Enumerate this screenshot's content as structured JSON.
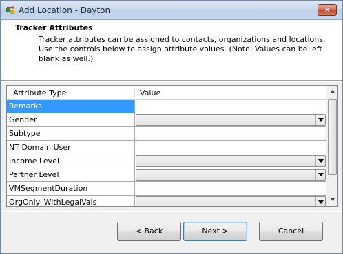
{
  "window": {
    "title": "Add Location - Dayton"
  },
  "header": {
    "title": "Tracker Attributes",
    "description": "Tracker attributes can be assigned to contacts, organizations and locations.  Use the controls below to assign attribute values.  (Note: Values can be left blank as well.)"
  },
  "grid": {
    "columns": [
      "Attribute Type",
      "Value"
    ],
    "rows": [
      {
        "label": "Remarks",
        "value": ""
      },
      {
        "label": "Gender",
        "value": ""
      },
      {
        "label": "Subtype",
        "value": ""
      },
      {
        "label": "NT Domain User",
        "value": ""
      },
      {
        "label": "Income Level",
        "value": ""
      },
      {
        "label": "Partner Level",
        "value": ""
      },
      {
        "label": "VMSegmentDuration",
        "value": ""
      },
      {
        "label": "OrgOnly_WithLegalVals",
        "value": ""
      }
    ]
  },
  "buttons": {
    "back": "< Back",
    "next": "Next >",
    "cancel": "Cancel"
  },
  "icons": {
    "close": "close-icon",
    "app": "app-icon"
  },
  "colors": {
    "selection": "#3399ff",
    "close_button": "#c24a2f"
  }
}
